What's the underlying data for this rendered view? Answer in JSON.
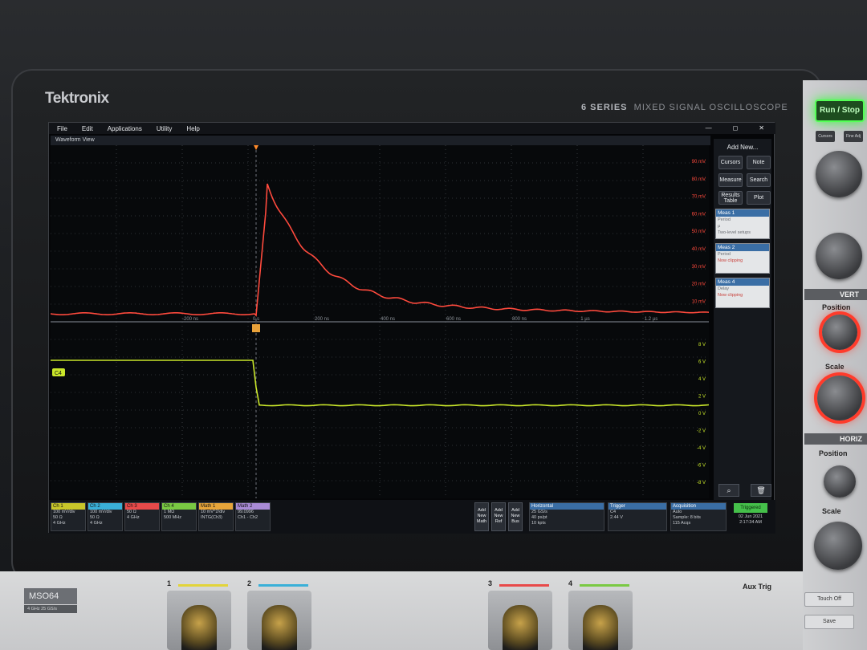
{
  "device": {
    "brand": "Tektronix",
    "series": "6 SERIES",
    "series_desc": "MIXED SIGNAL OSCILLOSCOPE",
    "model": "MSO64",
    "model_sub": "4 GHz  25 GS/s"
  },
  "menu": [
    "File",
    "Edit",
    "Applications",
    "Utility",
    "Help"
  ],
  "window_title": "Waveform View",
  "sidebar": {
    "header": "Add New...",
    "buttons": [
      "Cursors",
      "Note",
      "Measure",
      "Search",
      "Results Table",
      "Plot"
    ],
    "measurements": [
      {
        "title": "Meas 1",
        "lines": [
          "Period",
          "µ",
          "Two-level setups"
        ],
        "color": "#3a6ea5"
      },
      {
        "title": "Meas 2",
        "lines": [
          "Period",
          "",
          "Now clipping"
        ],
        "color": "#3a6ea5"
      },
      {
        "title": "Meas 4",
        "lines": [
          "Delay",
          "",
          "Now clipping"
        ],
        "color": "#3a6ea5"
      }
    ]
  },
  "traces": {
    "upper": {
      "color": "#ff4a3d",
      "y_labels": [
        "90 mV",
        "80 mV",
        "70 mV",
        "60 mV",
        "50 mV",
        "40 mV",
        "30 mV",
        "20 mV",
        "10 mV"
      ],
      "x_labels": [
        "-200 ns",
        "0 s",
        "200 ns",
        "400 ns",
        "600 ns",
        "800 ns",
        "1 µs",
        "1.2 µs"
      ]
    },
    "lower": {
      "color": "#c9e62a",
      "marker": "C4",
      "y_labels": [
        "8 V",
        "6 V",
        "4 V",
        "2 V",
        "0 V",
        "-2 V",
        "-4 V",
        "-6 V",
        "-8 V"
      ]
    }
  },
  "channels": [
    {
      "name": "Ch 1",
      "lines": [
        "100 mV/div",
        "50 Ω",
        "4 GHz"
      ],
      "color": "#c9c62a"
    },
    {
      "name": "Ch 2",
      "lines": [
        "100 mV/div",
        "50 Ω",
        "4 GHz"
      ],
      "color": "#3ab0d8"
    },
    {
      "name": "Ch 3",
      "lines": [
        "",
        "50 Ω",
        "4 GHz"
      ],
      "color": "#e84a4a"
    },
    {
      "name": "Ch 4",
      "lines": [
        "",
        "1 MΩ",
        "500 MHz"
      ],
      "color": "#7ac943"
    },
    {
      "name": "Math 1",
      "lines": [
        "10 mV^2/div",
        "INTG(Ch3)"
      ],
      "color": "#e7a53a"
    },
    {
      "name": "Math 2",
      "lines": [
        "99.0996",
        "Ch1 - Ch2"
      ],
      "color": "#a98bd6"
    }
  ],
  "add_buttons": [
    "Add New Math",
    "Add New Ref",
    "Add New Bus"
  ],
  "horizontal": {
    "title": "Horizontal",
    "lines": [
      "25 GS/s",
      "40 ps/pt",
      "10 kpts"
    ]
  },
  "trigger": {
    "title": "Trigger",
    "lines": [
      "C4",
      "2.44 V"
    ]
  },
  "acquisition": {
    "title": "Acquisition",
    "lines": [
      "Auto",
      "Sample: 8 bits",
      "115 Acqs"
    ]
  },
  "status": "Triggered",
  "datetime": [
    "02 Jun 2021",
    "2:17:34 AM"
  ],
  "controls": {
    "run_stop": "Run / Stop",
    "small_btns": [
      "Cursors",
      "Fine Adj"
    ],
    "vert_title": "VERT",
    "horiz_title": "HORIZ",
    "position": "Position",
    "scale": "Scale",
    "aux_trig": "Aux Trig",
    "touch_off": "Touch Off",
    "save": "Save"
  },
  "channel_numbers": [
    "1",
    "2",
    "3",
    "4"
  ]
}
